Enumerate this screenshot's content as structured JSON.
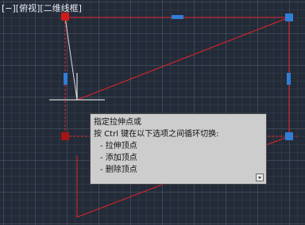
{
  "viewport": {
    "label": "[−][俯视][二维线框]"
  },
  "colors": {
    "background": "#242b38",
    "polyline": "#e0232b",
    "grip_vertex": "#d11a1a",
    "grip_midpoint": "#2f7fd8",
    "crosshair": "#ffffff",
    "tooltip_bg": "#cdcdcd"
  },
  "tooltip": {
    "title": "指定拉伸点或",
    "instruction": "按 Ctrl 键在以下选项之间循环切换:",
    "options": [
      "-  拉伸顶点",
      "-  添加顶点",
      "-  删除顶点"
    ],
    "expand_icon": "chevron-down-icon"
  }
}
